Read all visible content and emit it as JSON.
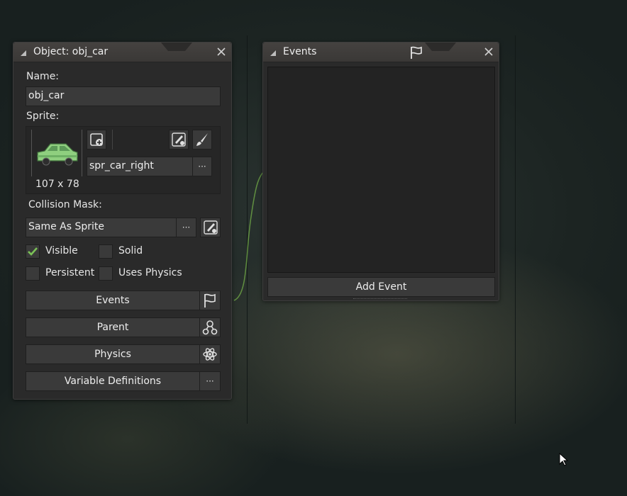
{
  "object_panel": {
    "title": "Object: obj_car",
    "name_label": "Name:",
    "name_value": "obj_car",
    "sprite_label": "Sprite:",
    "sprite_name": "spr_car_right",
    "sprite_size": "107 x 78",
    "collision_mask_label": "Collision Mask:",
    "collision_mask_value": "Same As Sprite",
    "checkboxes": {
      "visible": {
        "label": "Visible",
        "checked": true
      },
      "solid": {
        "label": "Solid",
        "checked": false
      },
      "persistent": {
        "label": "Persistent",
        "checked": false
      },
      "uses_physics": {
        "label": "Uses Physics",
        "checked": false
      }
    },
    "buttons": {
      "events": "Events",
      "parent": "Parent",
      "physics": "Physics",
      "variable_definitions": "Variable Definitions"
    },
    "more_label": "···"
  },
  "events_panel": {
    "title": "Events",
    "add_event": "Add Event"
  },
  "colors": {
    "accent_green": "#7bc257",
    "panel_bg": "#2a2a2a",
    "field_bg": "#3a3a3a",
    "titlebar_bg": "#3e3c3a",
    "connector": "#6fa846"
  },
  "icons": {
    "panel_collapse": "triangle-icon",
    "close": "close-icon",
    "events": "flag-icon",
    "parent": "hierarchy-icon",
    "physics": "atom-icon",
    "new_sprite": "new-sprite-icon",
    "edit_sprite": "edit-sprite-icon",
    "edit_image": "paintbrush-icon",
    "more": "ellipsis-icon",
    "cursor": "mouse-pointer-icon"
  }
}
